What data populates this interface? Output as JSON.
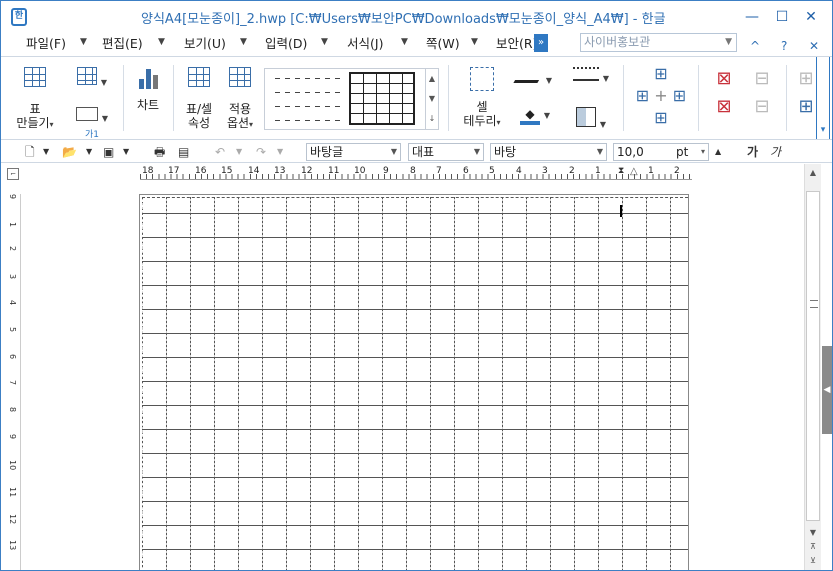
{
  "window": {
    "title": "양식A4[모눈종이]_2.hwp [C:₩Users₩보안PC₩Downloads₩모눈종이_양식_A4₩] - 한글",
    "app_icon_label": "한"
  },
  "window_controls": {
    "minimize": "—",
    "maximize": "☐",
    "close": "✕"
  },
  "menubar": {
    "items": [
      "파일(F)",
      "편집(E)",
      "보기(U)",
      "입력(D)",
      "서식(J)",
      "쪽(W)",
      "보안(R)"
    ],
    "search_placeholder": "사이버홍보관",
    "right_buttons": [
      "^",
      "?",
      "✕"
    ]
  },
  "ribbon": {
    "table_create": {
      "line1": "표",
      "line2": "만들기"
    },
    "text_box_label": "가1",
    "chart": "차트",
    "cell_props": {
      "line1": "표/셀",
      "line2": "속성"
    },
    "apply_options": {
      "line1": "적용",
      "line2": "옵션"
    },
    "cell_border": {
      "line1": "셀",
      "line2": "테두리"
    }
  },
  "formatbar": {
    "style": "바탕글",
    "font_lang": "대표",
    "font": "바탕",
    "size": "10,0",
    "unit": "pt",
    "bold_label": "가",
    "italic_label": "가"
  },
  "ruler": {
    "h_labels": [
      "18",
      "17",
      "16",
      "15",
      "14",
      "13",
      "12",
      "11",
      "10",
      "9",
      "8",
      "7",
      "6",
      "5",
      "4",
      "3",
      "2",
      "1",
      "1",
      "2"
    ],
    "v_labels": [
      "1",
      "2",
      "3",
      "4",
      "5",
      "6",
      "7",
      "8",
      "9",
      "10",
      "11",
      "12",
      "13"
    ]
  },
  "colors": {
    "accent": "#2f78c2",
    "title": "#2f6fb3",
    "grid": "#555555"
  }
}
